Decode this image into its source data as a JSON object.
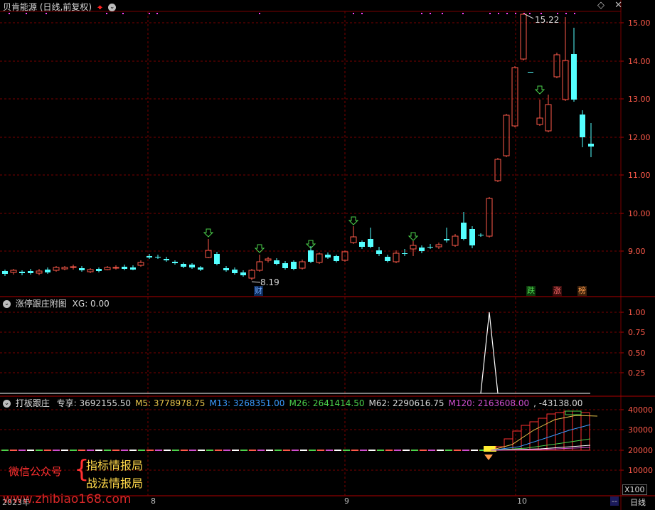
{
  "main": {
    "stock_name": "贝肯能源",
    "period": "(日线,前复权)",
    "y_ticks": [
      "15.00",
      "14.00",
      "13.00",
      "12.00",
      "11.00",
      "10.00",
      "9.00"
    ],
    "high_label": "15.22",
    "low_label": "8.19",
    "flags": [
      {
        "text": "财",
        "color": "#6fa8ff",
        "bg": "#0b2a5a"
      },
      {
        "text": "跌",
        "color": "#4cd34c",
        "bg": "#0c3a0c"
      },
      {
        "text": "涨",
        "color": "#ff6a6a",
        "bg": "#3a0c0c"
      },
      {
        "text": "榜",
        "color": "#ff9c4a",
        "bg": "#3a200c"
      }
    ]
  },
  "sub1": {
    "title": "涨停跟庄附图",
    "xg_label": "XG: 0.00",
    "y_ticks": [
      "1.00",
      "0.75",
      "0.50",
      "0.25"
    ]
  },
  "sub2": {
    "title": "打板跟庄",
    "items": [
      {
        "text": "专享: 3692155.50",
        "color": "#d8d8d8"
      },
      {
        "text": "M5: 3778978.75",
        "color": "#e6c34a"
      },
      {
        "text": "M13: 3268351.00",
        "color": "#3a9bff"
      },
      {
        "text": "M26: 2641414.50",
        "color": "#4cd34c"
      },
      {
        "text": "M62: 2290616.75",
        "color": "#d8d8d8"
      },
      {
        "text": "M120: 2163608.00",
        "color": "#d04fd0"
      },
      {
        "text": ", -43138.00",
        "color": "#d8d8d8"
      }
    ],
    "y_ticks": [
      "40000",
      "30000",
      "20000",
      "10000"
    ],
    "scale": "X100"
  },
  "axis": {
    "labels": [
      "2023年",
      "8",
      "9",
      "10"
    ],
    "period_button": "日线",
    "more_button": "--"
  },
  "watermark": {
    "left": "微信公众号",
    "line1": "指标情报局",
    "line2": "战法情报局",
    "url": "www.zhibiao168.com"
  },
  "colors": {
    "up": "#ff5a4a",
    "down": "#54ffff",
    "grid": "#7a0000",
    "dot": "#ff40ff"
  }
}
